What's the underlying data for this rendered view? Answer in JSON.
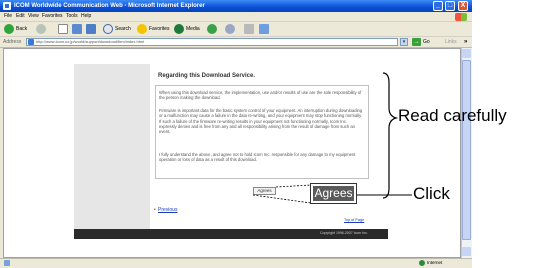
{
  "window": {
    "title": "ICOM Worldwide Communication Web - Microsoft Internet Explorer",
    "controls": {
      "minimize": "_",
      "maximize": "□",
      "close": "X"
    }
  },
  "menu": [
    "File",
    "Edit",
    "View",
    "Favorites",
    "Tools",
    "Help"
  ],
  "toolbar": {
    "back": "Back",
    "search": "Search",
    "favorites": "Favorites",
    "media": "Media"
  },
  "address": {
    "label": "Address",
    "value": "http://www.icom.co.jp/world/support/download/firm/index.html",
    "go": "Go",
    "links": "Links"
  },
  "page": {
    "heading": "Regarding this Download Service.",
    "paragraphs": [
      "When using this download service, the implementation, use and/or results of use are the sole responsibility of the person making the download.",
      "Firmware is important data for the basic system control of your equipment. An interruption during downloading or a malfunction may cause a failure in the data re-writing, and your equipment may stop functioning normally. If such a failure of the firmware re-writing results in your equipment not functioning normally, Icom Inc. expressly denies and is free from any and all responsibility arising from the result of damage from such an event.",
      "I fully understand the above, and agree not to hold Icom Inc. responsible for any damage to my equipment operation or loss of data as a result of this download."
    ],
    "agrees_button": "Agrees",
    "previous_link": "Previous",
    "top_link": "Top of Page",
    "copyright": "Copyright 1996-2007 Icom Inc."
  },
  "status": {
    "zone": "Internet"
  },
  "callouts": {
    "zoom_agrees": "Agrees",
    "read_carefully": "Read carefully",
    "click": "Click"
  }
}
